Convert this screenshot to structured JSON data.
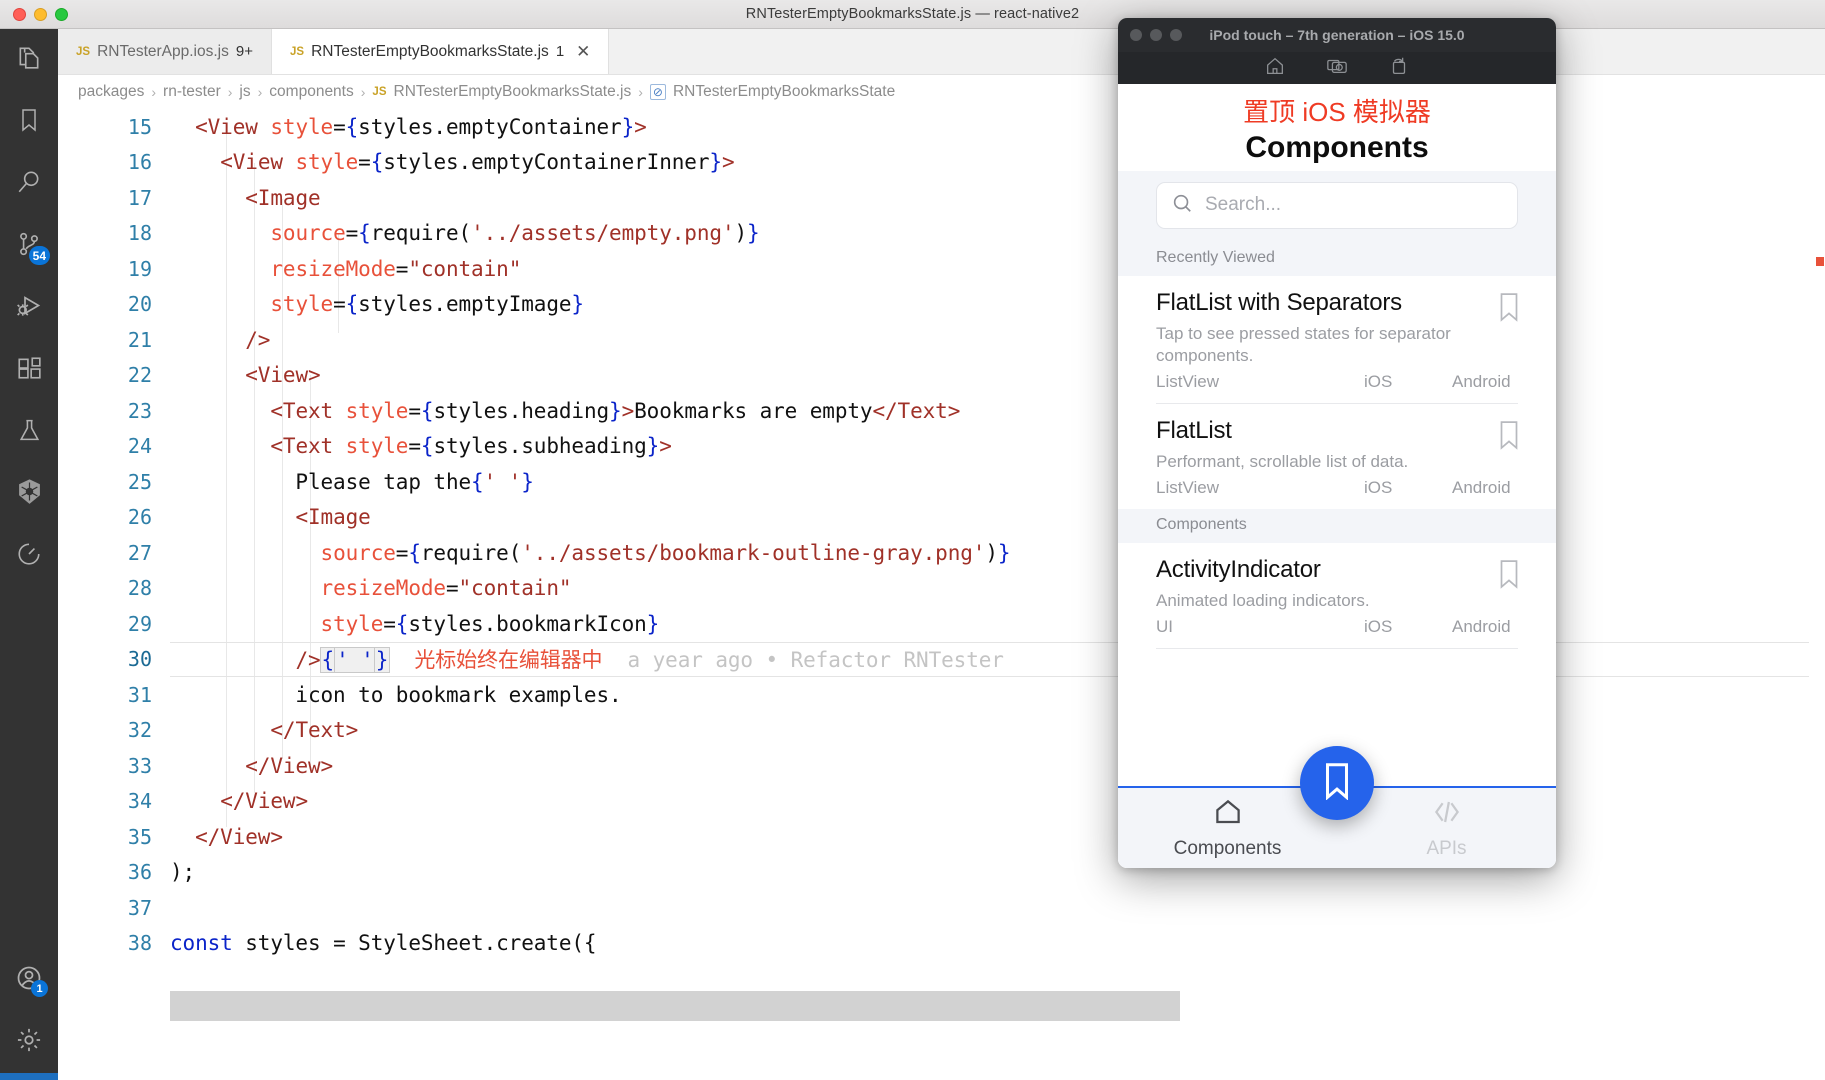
{
  "window": {
    "title": "RNTesterEmptyBookmarksState.js — react-native2",
    "traffic_lights": [
      "close",
      "minimize",
      "zoom"
    ]
  },
  "activity_bar": {
    "items": [
      {
        "name": "explorer",
        "icon": "files-icon",
        "badge": null
      },
      {
        "name": "bookmarks",
        "icon": "bookmark-icon",
        "badge": null
      },
      {
        "name": "search",
        "icon": "search-icon",
        "badge": null
      },
      {
        "name": "source-control",
        "icon": "source-control-icon",
        "badge": "54"
      },
      {
        "name": "run-and-debug",
        "icon": "debug-icon",
        "badge": null
      },
      {
        "name": "extensions",
        "icon": "extensions-icon",
        "badge": null
      },
      {
        "name": "testing",
        "icon": "flask-icon",
        "badge": null
      },
      {
        "name": "kubernetes",
        "icon": "kubernetes-icon",
        "badge": null
      },
      {
        "name": "timeline",
        "icon": "clock-icon",
        "badge": null
      }
    ],
    "bottom_items": [
      {
        "name": "accounts",
        "icon": "account-icon",
        "badge": "1"
      },
      {
        "name": "settings",
        "icon": "gear-icon",
        "badge": null
      }
    ]
  },
  "tabs": [
    {
      "lang": "JS",
      "label": "RNTesterApp.ios.js",
      "count": "9+",
      "active": false,
      "closable": false
    },
    {
      "lang": "JS",
      "label": "RNTesterEmptyBookmarksState.js",
      "count": "1",
      "active": true,
      "closable": true,
      "close_glyph": "✕"
    }
  ],
  "breadcrumb": {
    "separator": "›",
    "items": [
      "packages",
      "rn-tester",
      "js",
      "components"
    ],
    "file_lang": "JS",
    "file": "RNTesterEmptyBookmarksState.js",
    "symbol": "RNTesterEmptyBookmarksState"
  },
  "editor": {
    "first_line": 15,
    "lines": [
      {
        "n": "15",
        "tokens": [
          {
            "t": "  ",
            "c": "plain"
          },
          {
            "t": "<View ",
            "c": "tag"
          },
          {
            "t": "style",
            "c": "attr"
          },
          {
            "t": "=",
            "c": "plain"
          },
          {
            "t": "{",
            "c": "brace"
          },
          {
            "t": "styles.emptyContainer",
            "c": "plain"
          },
          {
            "t": "}",
            "c": "brace"
          },
          {
            "t": ">",
            "c": "tag"
          }
        ]
      },
      {
        "n": "16",
        "tokens": [
          {
            "t": "    ",
            "c": "plain"
          },
          {
            "t": "<View ",
            "c": "tag"
          },
          {
            "t": "style",
            "c": "attr"
          },
          {
            "t": "=",
            "c": "plain"
          },
          {
            "t": "{",
            "c": "brace"
          },
          {
            "t": "styles.emptyContainerInner",
            "c": "plain"
          },
          {
            "t": "}",
            "c": "brace"
          },
          {
            "t": ">",
            "c": "tag"
          }
        ]
      },
      {
        "n": "17",
        "tokens": [
          {
            "t": "      ",
            "c": "plain"
          },
          {
            "t": "<Image",
            "c": "tag"
          }
        ]
      },
      {
        "n": "18",
        "tokens": [
          {
            "t": "        ",
            "c": "plain"
          },
          {
            "t": "source",
            "c": "attr"
          },
          {
            "t": "=",
            "c": "plain"
          },
          {
            "t": "{",
            "c": "brace"
          },
          {
            "t": "require(",
            "c": "plain"
          },
          {
            "t": "'../assets/empty.png'",
            "c": "str"
          },
          {
            "t": ")",
            "c": "plain"
          },
          {
            "t": "}",
            "c": "brace"
          }
        ]
      },
      {
        "n": "19",
        "tokens": [
          {
            "t": "        ",
            "c": "plain"
          },
          {
            "t": "resizeMode",
            "c": "attr"
          },
          {
            "t": "=",
            "c": "plain"
          },
          {
            "t": "\"contain\"",
            "c": "str"
          }
        ]
      },
      {
        "n": "20",
        "tokens": [
          {
            "t": "        ",
            "c": "plain"
          },
          {
            "t": "style",
            "c": "attr"
          },
          {
            "t": "=",
            "c": "plain"
          },
          {
            "t": "{",
            "c": "brace"
          },
          {
            "t": "styles.emptyImage",
            "c": "plain"
          },
          {
            "t": "}",
            "c": "brace"
          }
        ]
      },
      {
        "n": "21",
        "tokens": [
          {
            "t": "      ",
            "c": "plain"
          },
          {
            "t": "/>",
            "c": "tag"
          }
        ]
      },
      {
        "n": "22",
        "tokens": [
          {
            "t": "      ",
            "c": "plain"
          },
          {
            "t": "<View>",
            "c": "tag"
          }
        ]
      },
      {
        "n": "23",
        "tokens": [
          {
            "t": "        ",
            "c": "plain"
          },
          {
            "t": "<Text ",
            "c": "tag"
          },
          {
            "t": "style",
            "c": "attr"
          },
          {
            "t": "=",
            "c": "plain"
          },
          {
            "t": "{",
            "c": "brace"
          },
          {
            "t": "styles.heading",
            "c": "plain"
          },
          {
            "t": "}",
            "c": "brace"
          },
          {
            "t": ">",
            "c": "tag"
          },
          {
            "t": "Bookmarks are empty",
            "c": "plain"
          },
          {
            "t": "</Text>",
            "c": "tag"
          }
        ]
      },
      {
        "n": "24",
        "tokens": [
          {
            "t": "        ",
            "c": "plain"
          },
          {
            "t": "<Text ",
            "c": "tag"
          },
          {
            "t": "style",
            "c": "attr"
          },
          {
            "t": "=",
            "c": "plain"
          },
          {
            "t": "{",
            "c": "brace"
          },
          {
            "t": "styles.subheading",
            "c": "plain"
          },
          {
            "t": "}",
            "c": "brace"
          },
          {
            "t": ">",
            "c": "tag"
          }
        ]
      },
      {
        "n": "25",
        "tokens": [
          {
            "t": "          Please tap the",
            "c": "plain"
          },
          {
            "t": "{",
            "c": "brace"
          },
          {
            "t": "' '",
            "c": "str"
          },
          {
            "t": "}",
            "c": "brace"
          }
        ]
      },
      {
        "n": "26",
        "tokens": [
          {
            "t": "          ",
            "c": "plain"
          },
          {
            "t": "<Image",
            "c": "tag"
          }
        ]
      },
      {
        "n": "27",
        "tokens": [
          {
            "t": "            ",
            "c": "plain"
          },
          {
            "t": "source",
            "c": "attr"
          },
          {
            "t": "=",
            "c": "plain"
          },
          {
            "t": "{",
            "c": "brace"
          },
          {
            "t": "require(",
            "c": "plain"
          },
          {
            "t": "'../assets/bookmark-outline-gray.png'",
            "c": "str"
          },
          {
            "t": ")",
            "c": "plain"
          },
          {
            "t": "}",
            "c": "brace"
          }
        ]
      },
      {
        "n": "28",
        "tokens": [
          {
            "t": "            ",
            "c": "plain"
          },
          {
            "t": "resizeMode",
            "c": "attr"
          },
          {
            "t": "=",
            "c": "plain"
          },
          {
            "t": "\"contain\"",
            "c": "str"
          }
        ]
      },
      {
        "n": "29",
        "tokens": [
          {
            "t": "            ",
            "c": "plain"
          },
          {
            "t": "style",
            "c": "attr"
          },
          {
            "t": "=",
            "c": "plain"
          },
          {
            "t": "{",
            "c": "brace"
          },
          {
            "t": "styles.bookmarkIcon",
            "c": "plain"
          },
          {
            "t": "}",
            "c": "brace"
          }
        ]
      },
      {
        "n": "30",
        "current": true,
        "tokens": [
          {
            "t": "          ",
            "c": "plain"
          },
          {
            "t": "/>",
            "c": "tag"
          },
          {
            "t": "{",
            "c": "ws"
          },
          {
            "t": "' '",
            "c": "ws-str"
          },
          {
            "t": "}",
            "c": "ws"
          }
        ],
        "annotation": "光标始终在编辑器中",
        "blame": "a year ago • Refactor RNTester"
      },
      {
        "n": "31",
        "tokens": [
          {
            "t": "          icon to bookmark examples.",
            "c": "plain"
          }
        ]
      },
      {
        "n": "32",
        "tokens": [
          {
            "t": "        ",
            "c": "plain"
          },
          {
            "t": "</Text>",
            "c": "tag"
          }
        ]
      },
      {
        "n": "33",
        "tokens": [
          {
            "t": "      ",
            "c": "plain"
          },
          {
            "t": "</View>",
            "c": "tag"
          }
        ]
      },
      {
        "n": "34",
        "tokens": [
          {
            "t": "    ",
            "c": "plain"
          },
          {
            "t": "</View>",
            "c": "tag"
          }
        ]
      },
      {
        "n": "35",
        "tokens": [
          {
            "t": "  ",
            "c": "plain"
          },
          {
            "t": "</View>",
            "c": "tag"
          }
        ]
      },
      {
        "n": "36",
        "tokens": [
          {
            "t": ");",
            "c": "plain"
          }
        ]
      },
      {
        "n": "37",
        "tokens": [
          {
            "t": "",
            "c": "plain"
          }
        ]
      },
      {
        "n": "38",
        "tokens": [
          {
            "t": "",
            "c": "plain"
          },
          {
            "t": "const",
            "c": "kw"
          },
          {
            "t": " styles = StyleSheet.create({",
            "c": "plain"
          }
        ]
      }
    ]
  },
  "simulator": {
    "title": "iPod touch – 7th generation – iOS 15.0",
    "toolbar_icons": [
      "home-icon",
      "camera-icon",
      "rotate-icon"
    ],
    "header": {
      "chinese_note": "置顶 iOS 模拟器",
      "title": "Components"
    },
    "search": {
      "placeholder": "Search...",
      "icon": "search-icon"
    },
    "sections": [
      {
        "header": "Recently Viewed",
        "items": [
          {
            "title": "FlatList with Separators",
            "description": "Tap to see pressed states for separator components.",
            "tags": [
              "ListView",
              "iOS",
              "Android"
            ],
            "bookmark_icon": "bookmark-outline-icon"
          },
          {
            "title": "FlatList",
            "description": "Performant, scrollable list of data.",
            "tags": [
              "ListView",
              "iOS",
              "Android"
            ],
            "bookmark_icon": "bookmark-outline-icon"
          }
        ]
      },
      {
        "header": "Components",
        "items": [
          {
            "title": "ActivityIndicator",
            "description": "Animated loading indicators.",
            "tags": [
              "UI",
              "iOS",
              "Android"
            ],
            "bookmark_icon": "bookmark-outline-icon"
          }
        ]
      }
    ],
    "fab": {
      "icon": "bookmark-filled-icon",
      "color": "#2563eb"
    },
    "tab_bar": {
      "active_indicator_color": "#2563eb",
      "tabs": [
        {
          "label": "Components",
          "icon": "home-icon",
          "active": true
        },
        {
          "label": "APIs",
          "icon": "code-icon",
          "active": false
        }
      ]
    }
  }
}
